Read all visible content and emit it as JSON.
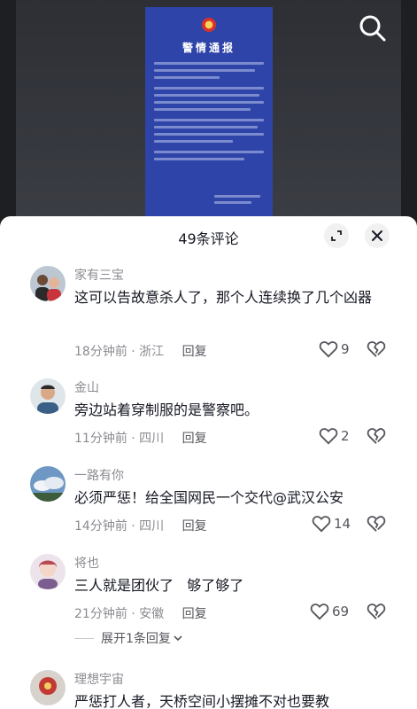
{
  "video": {
    "notice_title": "警情通报"
  },
  "comments_panel": {
    "title": "49条评论"
  },
  "comments": [
    {
      "username": "家有三宝",
      "text": "这可以告故意杀人了，那个人连续换了几个凶器",
      "time_location": "18分钟前 · 浙江",
      "reply_label": "回复",
      "likes": "9"
    },
    {
      "username": "金山",
      "text": "旁边站着穿制服的是警察吧。",
      "time_location": "11分钟前 · 四川",
      "reply_label": "回复",
      "likes": "2"
    },
    {
      "username": "一路有你",
      "text": "必须严惩！给全国网民一个交代@武汉公安",
      "time_location": "14分钟前 · 四川",
      "reply_label": "回复",
      "likes": "14"
    },
    {
      "username": "将也",
      "text": "三人就是团伙了   够了够了",
      "time_location": "21分钟前 · 安徽",
      "reply_label": "回复",
      "likes": "69",
      "expand_replies": "展开1条回复"
    },
    {
      "username": "理想宇宙",
      "text": "严惩打人者，天桥空间小摆摊不对也要教"
    }
  ],
  "colors": {
    "accent_text": "#161823",
    "secondary_text": "#8a8b91",
    "notice_blue": "#2e44a8"
  }
}
